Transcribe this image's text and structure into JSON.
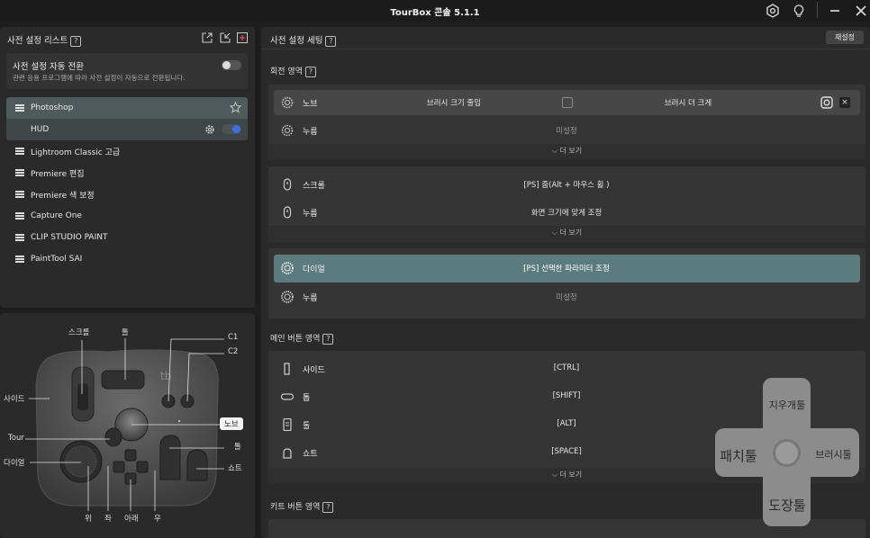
{
  "app": {
    "title": "TourBox 콘솔 5.1.1"
  },
  "left": {
    "header": "사전 설정 리스트",
    "auto_switch": {
      "title": "사전 설정 자동 전환",
      "subtitle": "관련 응용 프로그램에 따라 사전 설정이 자동으로 전환됩니다."
    },
    "presets": [
      {
        "label": "Photoshop"
      },
      {
        "label": "HUD"
      },
      {
        "label": "Lightroom Classic 고급"
      },
      {
        "label": "Premiere 편집"
      },
      {
        "label": "Premiere 색 보정"
      },
      {
        "label": "Capture One"
      },
      {
        "label": "CLIP STUDIO PAINT"
      },
      {
        "label": "PaintTool SAI"
      }
    ]
  },
  "device": {
    "labels": {
      "scroll": "스크롤",
      "tall": "톨",
      "c1": "C1",
      "c2": "C2",
      "side": "사이드",
      "knob": "노브",
      "tour": "Tour",
      "dial": "다이얼",
      "tall2": "톨",
      "short": "쇼트",
      "up": "위",
      "left": "좌",
      "down": "아래",
      "right": "우"
    }
  },
  "right": {
    "header": "사전 설정 세팅",
    "reset_label": "재설정",
    "rotation_title": "회전 영역",
    "main_title": "메인 버튼 영역",
    "kit_title": "키트 버튼 영역",
    "more_label": "더 보기",
    "knob_rows": [
      {
        "label": "노브",
        "left": "브러시 크기 줄임",
        "right": "브러시 더 크게"
      },
      {
        "label": "누름",
        "value": "미설정"
      }
    ],
    "scroll_rows": [
      {
        "label": "스크롤",
        "value": "[PS] 줌(Alt + 마우스 휠 )"
      },
      {
        "label": "누름",
        "value": "화면 크기에 맞게 조정"
      }
    ],
    "dial_rows": [
      {
        "label": "다이얼",
        "value": "[PS] 선택한 파라미터 조정"
      },
      {
        "label": "누름",
        "value": "미설정"
      }
    ],
    "main_rows": [
      {
        "label": "사이드",
        "value": "[CTRL]"
      },
      {
        "label": "톱",
        "value": "[SHIFT]"
      },
      {
        "label": "톨",
        "value": "[ALT]"
      },
      {
        "label": "쇼트",
        "value": "[SPACE]"
      }
    ]
  },
  "dpad": {
    "up": "지우개툴",
    "left": "패치툴",
    "right": "브러시툴",
    "down": "도장툴"
  },
  "colors": {
    "accent": "#5c7b7e",
    "toggle_on": "#3d6fe0",
    "star": "#cccccc"
  }
}
